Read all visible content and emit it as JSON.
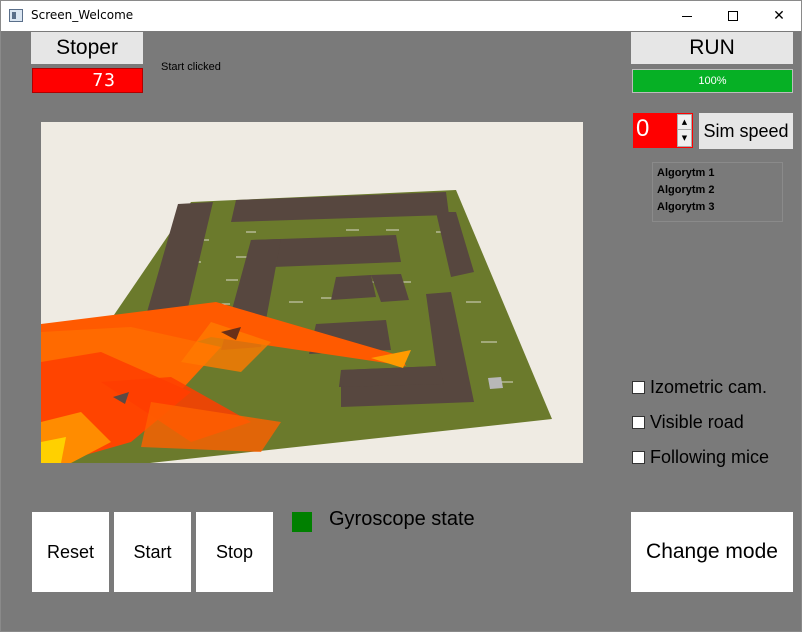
{
  "window": {
    "title": "Screen_Welcome",
    "controls": {
      "minimize_icon": "minimize-icon",
      "maximize_icon": "maximize-icon",
      "close_glyph": "✕"
    }
  },
  "stoper": {
    "label": "Stoper",
    "display_value": "73",
    "color": "#ff0000"
  },
  "status": {
    "text": "Start clicked"
  },
  "run": {
    "label": "RUN"
  },
  "progress": {
    "value_percent": 100,
    "label": "100%",
    "color": "#06b025"
  },
  "sim_speed": {
    "value": "0",
    "label": "Sim speed",
    "up_arrow": "▲",
    "down_arrow": "▼"
  },
  "algorithms": [
    "Algorytm 1",
    "Algorytm 2",
    "Algorytm 3"
  ],
  "options": [
    {
      "label": "Izometric cam.",
      "checked": false
    },
    {
      "label": "Visible road",
      "checked": false
    },
    {
      "label": "Following mice",
      "checked": false
    }
  ],
  "controls": {
    "reset": "Reset",
    "start": "Start",
    "stop": "Stop",
    "change_mode": "Change mode"
  },
  "gyroscope": {
    "label": "Gyroscope state",
    "color": "#008000"
  }
}
